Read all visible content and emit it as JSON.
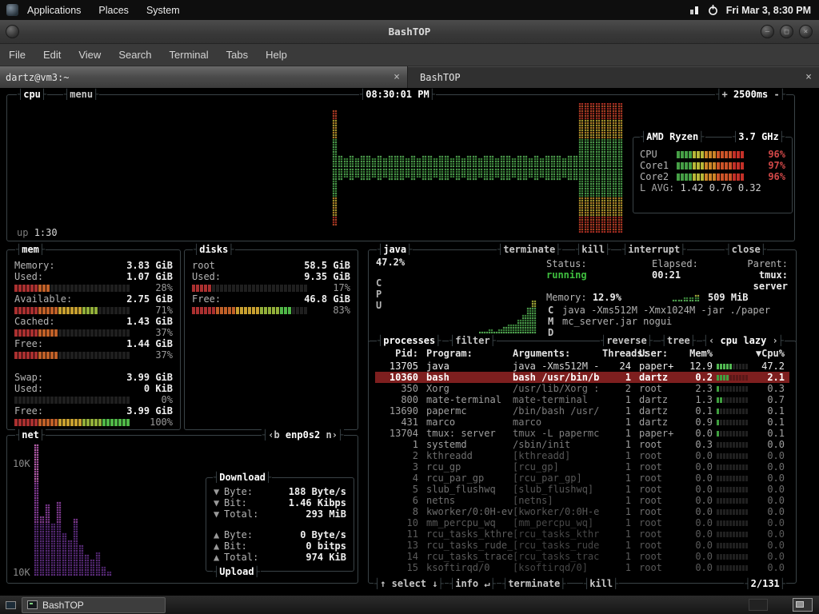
{
  "panel": {
    "menus": [
      "Applications",
      "Places",
      "System"
    ],
    "clock": "Fri Mar 3, 8:30 PM"
  },
  "window": {
    "title": "BashTOP",
    "menu": [
      "File",
      "Edit",
      "View",
      "Search",
      "Terminal",
      "Tabs",
      "Help"
    ],
    "tabs": [
      {
        "label": "dartz@vm3:~",
        "close": "×"
      },
      {
        "label": "BashTOP",
        "close": "×"
      }
    ]
  },
  "taskbar": {
    "task_label": "BashTOP"
  },
  "bashtop": {
    "colors": {
      "selected_row_bg": "#7e1f1f",
      "running_green": "#3fbf3f",
      "alert_red": "#d24848",
      "graph_green": "#5fc25f",
      "graph_yellow": "#d0b838",
      "graph_red": "#c43428",
      "net_purple": "#a24cb4"
    },
    "cpu": {
      "box_title": "cpu",
      "menu_button": "menu",
      "time": "08:30:01 PM",
      "interval": {
        "plus": "+",
        "value": "2500ms",
        "minus": "-"
      },
      "uptime_label": "up",
      "uptime": "1:30",
      "model": "AMD Ryzen",
      "freq": "3.7 GHz",
      "meters": [
        {
          "label": "CPU",
          "pct": 96,
          "pct_text": "96%"
        },
        {
          "label": "Core1",
          "pct": 97,
          "pct_text": "97%"
        },
        {
          "label": "Core2",
          "pct": 96,
          "pct_text": "96%"
        }
      ],
      "load_avg_label": "L AVG:",
      "load_avg": "1.42 0.76 0.32",
      "history": [
        0,
        0,
        0,
        0,
        0,
        0,
        0,
        0,
        0,
        0,
        0,
        0,
        0,
        0,
        0,
        0,
        0,
        0,
        0,
        0,
        0,
        0,
        0,
        0,
        0,
        0,
        0,
        0,
        0,
        0,
        0,
        0,
        0,
        0,
        0,
        0,
        0,
        0,
        0,
        0,
        0,
        0,
        0,
        0,
        0,
        0,
        0,
        0,
        0,
        0,
        0,
        0,
        0,
        0,
        0,
        0,
        0,
        88,
        18,
        15,
        19,
        16,
        20,
        17,
        15,
        18,
        16,
        19,
        17,
        20,
        15,
        18,
        16,
        17,
        19,
        15,
        18,
        20,
        16,
        17,
        15,
        19,
        18,
        16,
        20,
        17,
        15,
        18,
        19,
        16,
        17,
        20,
        15,
        18,
        16,
        19,
        17,
        18,
        15,
        20,
        17,
        100,
        100,
        100,
        100,
        100,
        100,
        100,
        100
      ]
    },
    "mem": {
      "box_title": "mem",
      "rows": [
        {
          "label": "Memory:",
          "value": "3.83 GiB"
        },
        {
          "label": "Used:",
          "value": "1.07 GiB",
          "pct": 28,
          "pct_text": "28%"
        },
        {
          "label": "Available:",
          "value": "2.75 GiB",
          "pct": 71,
          "pct_text": "71%"
        },
        {
          "label": "Cached:",
          "value": "1.43 GiB",
          "pct": 37,
          "pct_text": "37%"
        },
        {
          "label": "Free:",
          "value": "1.44 GiB",
          "pct": 37,
          "pct_text": "37%"
        },
        {
          "label": "Swap:",
          "value": "3.99 GiB",
          "gap": true
        },
        {
          "label": "Used:",
          "value": "0 KiB",
          "pct": 0,
          "pct_text": "0%"
        },
        {
          "label": "Free:",
          "value": "3.99 GiB",
          "pct": 100,
          "pct_text": "100%"
        }
      ]
    },
    "disks": {
      "box_title": "disks",
      "name": "root",
      "size": "58.5 GiB",
      "rows": [
        {
          "label": "Used:",
          "value": "9.35 GiB",
          "pct": 17,
          "pct_text": "17%"
        },
        {
          "label": "Free:",
          "value": "46.8 GiB",
          "pct": 83,
          "pct_text": "83%"
        }
      ]
    },
    "net": {
      "box_title": "net",
      "selector_prev": "‹b",
      "selector_if": "enp0s2",
      "selector_next": "n›",
      "scale_top": "10K",
      "scale_bottom": "10K",
      "download_title": "Download",
      "upload_title": "Upload",
      "download_rows": [
        {
          "arrow": "▼",
          "label": "Byte:",
          "value": "188 Byte/s"
        },
        {
          "arrow": "▼",
          "label": "Bit:",
          "value": "1.46 Kibps"
        },
        {
          "arrow": "▼",
          "label": "Total:",
          "value": "293 MiB"
        }
      ],
      "upload_rows": [
        {
          "arrow": "▲",
          "label": "Byte:",
          "value": "0 Byte/s"
        },
        {
          "arrow": "▲",
          "label": "Bit:",
          "value": "0 bitps"
        },
        {
          "arrow": "▲",
          "label": "Total:",
          "value": "974 KiB"
        }
      ],
      "history": [
        100,
        46,
        54,
        40,
        57,
        33,
        28,
        43,
        24,
        16,
        12,
        18,
        8,
        4,
        0,
        0,
        0,
        0,
        0,
        0,
        0,
        0,
        0,
        0,
        0,
        0,
        0,
        0
      ]
    },
    "detail": {
      "box_title": "java",
      "cpu_pct": "47.2%",
      "buttons": [
        "terminate",
        "kill",
        "interrupt"
      ],
      "close_button": "close",
      "axis_letters": [
        "C",
        "P",
        "U"
      ],
      "status_label": "Status:",
      "status": "running",
      "elapsed_label": "Elapsed:",
      "elapsed": "00:21",
      "parent_label": "Parent:",
      "parent": "tmux: server",
      "memory_label": "Memory:",
      "memory_pct": "12.9%",
      "memory_value": "509 MiB",
      "cmd_letters": [
        "C",
        "M",
        "D"
      ],
      "cmd_lines": [
        "java -Xms512M -Xmx1024M -jar ./paper",
        "mc_server.jar nogui"
      ],
      "history": [
        4,
        6,
        8,
        6,
        12,
        16,
        22,
        20,
        30,
        44,
        58,
        76
      ],
      "memory_history": [
        0,
        0,
        0,
        0,
        0,
        0,
        0,
        0,
        25,
        40,
        55,
        70,
        85
      ]
    },
    "processes": {
      "box_title": "processes",
      "filter_button": "filter",
      "reverse_button": "reverse",
      "tree_button": "tree",
      "sort": {
        "prev": "‹",
        "label": "cpu lazy",
        "next": "›"
      },
      "headers": {
        "pid": "Pid:",
        "program": "Program:",
        "args": "Arguments:",
        "threads": "Threads:",
        "user": "User:",
        "mem": "Mem%",
        "cpu": "▼Cpu%"
      },
      "rows": [
        {
          "pid": "13705",
          "program": "java",
          "args": "java -Xms512M -",
          "threads": "24",
          "user": "paper+",
          "mem": "12.9",
          "cpu": "47.2",
          "tier": "bright",
          "graph": 5
        },
        {
          "pid": "10360",
          "program": "bash",
          "args": "bash /usr/bin/b",
          "threads": "1",
          "user": "dartz",
          "mem": "0.2",
          "cpu": "2.1",
          "tier": "selected",
          "graph": 4
        },
        {
          "pid": "350",
          "program": "Xorg",
          "args": "/usr/lib/Xorg :",
          "threads": "2",
          "user": "root",
          "mem": "2.3",
          "cpu": "0.3",
          "tier": "mid",
          "graph": 1
        },
        {
          "pid": "800",
          "program": "mate-terminal",
          "args": "mate-terminal",
          "threads": "1",
          "user": "dartz",
          "mem": "1.3",
          "cpu": "0.7",
          "tier": "mid",
          "graph": 2
        },
        {
          "pid": "13690",
          "program": "papermc",
          "args": "/bin/bash /usr/",
          "threads": "1",
          "user": "dartz",
          "mem": "0.1",
          "cpu": "0.1",
          "tier": "mid",
          "graph": 1
        },
        {
          "pid": "431",
          "program": "marco",
          "args": "marco",
          "threads": "1",
          "user": "dartz",
          "mem": "0.9",
          "cpu": "0.1",
          "tier": "mid",
          "graph": 1
        },
        {
          "pid": "13704",
          "program": "tmux: server",
          "args": "tmux -L papermc",
          "threads": "1",
          "user": "paper+",
          "mem": "0.0",
          "cpu": "0.1",
          "tier": "mid",
          "graph": 1
        },
        {
          "pid": "1",
          "program": "systemd",
          "args": "/sbin/init",
          "threads": "1",
          "user": "root",
          "mem": "0.3",
          "cpu": "0.0",
          "tier": "mid",
          "graph": 0
        },
        {
          "pid": "2",
          "program": "kthreadd",
          "args": "[kthreadd]",
          "threads": "1",
          "user": "root",
          "mem": "0.0",
          "cpu": "0.0",
          "tier": "dim",
          "graph": 0
        },
        {
          "pid": "3",
          "program": "rcu_gp",
          "args": "[rcu_gp]",
          "threads": "1",
          "user": "root",
          "mem": "0.0",
          "cpu": "0.0",
          "tier": "dim",
          "graph": 0
        },
        {
          "pid": "4",
          "program": "rcu_par_gp",
          "args": "[rcu_par_gp]",
          "threads": "1",
          "user": "root",
          "mem": "0.0",
          "cpu": "0.0",
          "tier": "dim",
          "graph": 0
        },
        {
          "pid": "5",
          "program": "slub_flushwq",
          "args": "[slub_flushwq]",
          "threads": "1",
          "user": "root",
          "mem": "0.0",
          "cpu": "0.0",
          "tier": "dim",
          "graph": 0
        },
        {
          "pid": "6",
          "program": "netns",
          "args": "[netns]",
          "threads": "1",
          "user": "root",
          "mem": "0.0",
          "cpu": "0.0",
          "tier": "dim",
          "graph": 0
        },
        {
          "pid": "8",
          "program": "kworker/0:0H-ev",
          "args": "[kworker/0:0H-e",
          "threads": "1",
          "user": "root",
          "mem": "0.0",
          "cpu": "0.0",
          "tier": "dim",
          "graph": 0
        },
        {
          "pid": "10",
          "program": "mm_percpu_wq",
          "args": "[mm_percpu_wq]",
          "threads": "1",
          "user": "root",
          "mem": "0.0",
          "cpu": "0.0",
          "tier": "dim2",
          "graph": 0
        },
        {
          "pid": "11",
          "program": "rcu_tasks_kthre",
          "args": "[rcu_tasks_kthr",
          "threads": "1",
          "user": "root",
          "mem": "0.0",
          "cpu": "0.0",
          "tier": "dim2",
          "graph": 0
        },
        {
          "pid": "13",
          "program": "rcu_tasks_rude_",
          "args": "[rcu_tasks_rude",
          "threads": "1",
          "user": "root",
          "mem": "0.0",
          "cpu": "0.0",
          "tier": "dim2",
          "graph": 0
        },
        {
          "pid": "14",
          "program": "rcu_tasks_trace",
          "args": "[rcu_tasks_trac",
          "threads": "1",
          "user": "root",
          "mem": "0.0",
          "cpu": "0.0",
          "tier": "dim2",
          "graph": 0
        },
        {
          "pid": "15",
          "program": "ksoftirqd/0",
          "args": "[ksoftirqd/0]",
          "threads": "1",
          "user": "root",
          "mem": "0.0",
          "cpu": "0.0",
          "tier": "dim2",
          "graph": 0
        }
      ],
      "footer": {
        "select": "↑ select ↓",
        "info": "info ↵",
        "terminate": "terminate",
        "kill": "kill",
        "position": "2/131"
      }
    }
  }
}
